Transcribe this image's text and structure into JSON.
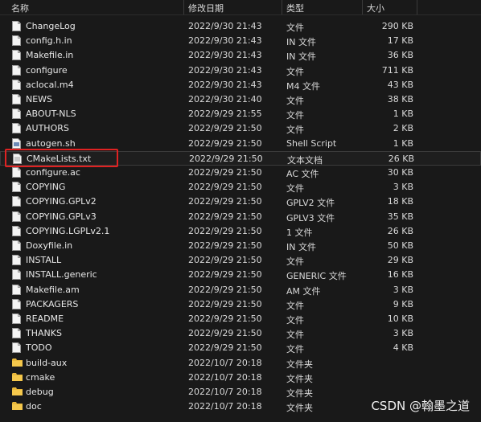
{
  "columns": {
    "name": "名称",
    "date": "修改日期",
    "type": "类型",
    "size": "大小"
  },
  "files": [
    {
      "name": "ChangeLog",
      "date": "2022/9/30 21:43",
      "type": "文件",
      "size": "290 KB",
      "icon": "file-icon"
    },
    {
      "name": "config.h.in",
      "date": "2022/9/30 21:43",
      "type": "IN 文件",
      "size": "17 KB",
      "icon": "file-icon"
    },
    {
      "name": "Makefile.in",
      "date": "2022/9/30 21:43",
      "type": "IN 文件",
      "size": "36 KB",
      "icon": "file-icon"
    },
    {
      "name": "configure",
      "date": "2022/9/30 21:43",
      "type": "文件",
      "size": "711 KB",
      "icon": "file-icon"
    },
    {
      "name": "aclocal.m4",
      "date": "2022/9/30 21:43",
      "type": "M4 文件",
      "size": "43 KB",
      "icon": "file-icon"
    },
    {
      "name": "NEWS",
      "date": "2022/9/30 21:40",
      "type": "文件",
      "size": "38 KB",
      "icon": "file-icon"
    },
    {
      "name": "ABOUT-NLS",
      "date": "2022/9/29 21:55",
      "type": "文件",
      "size": "1 KB",
      "icon": "file-icon"
    },
    {
      "name": "AUTHORS",
      "date": "2022/9/29 21:50",
      "type": "文件",
      "size": "2 KB",
      "icon": "file-icon"
    },
    {
      "name": "autogen.sh",
      "date": "2022/9/29 21:50",
      "type": "Shell Script",
      "size": "1 KB",
      "icon": "script-file-icon"
    },
    {
      "name": "CMakeLists.txt",
      "date": "2022/9/29 21:50",
      "type": "文本文档",
      "size": "26 KB",
      "icon": "text-file-icon"
    },
    {
      "name": "configure.ac",
      "date": "2022/9/29 21:50",
      "type": "AC 文件",
      "size": "30 KB",
      "icon": "file-icon"
    },
    {
      "name": "COPYING",
      "date": "2022/9/29 21:50",
      "type": "文件",
      "size": "3 KB",
      "icon": "file-icon"
    },
    {
      "name": "COPYING.GPLv2",
      "date": "2022/9/29 21:50",
      "type": "GPLV2 文件",
      "size": "18 KB",
      "icon": "file-icon"
    },
    {
      "name": "COPYING.GPLv3",
      "date": "2022/9/29 21:50",
      "type": "GPLV3 文件",
      "size": "35 KB",
      "icon": "file-icon"
    },
    {
      "name": "COPYING.LGPLv2.1",
      "date": "2022/9/29 21:50",
      "type": "1 文件",
      "size": "26 KB",
      "icon": "file-icon"
    },
    {
      "name": "Doxyfile.in",
      "date": "2022/9/29 21:50",
      "type": "IN 文件",
      "size": "50 KB",
      "icon": "file-icon"
    },
    {
      "name": "INSTALL",
      "date": "2022/9/29 21:50",
      "type": "文件",
      "size": "29 KB",
      "icon": "file-icon"
    },
    {
      "name": "INSTALL.generic",
      "date": "2022/9/29 21:50",
      "type": "GENERIC 文件",
      "size": "16 KB",
      "icon": "file-icon"
    },
    {
      "name": "Makefile.am",
      "date": "2022/9/29 21:50",
      "type": "AM 文件",
      "size": "3 KB",
      "icon": "file-icon"
    },
    {
      "name": "PACKAGERS",
      "date": "2022/9/29 21:50",
      "type": "文件",
      "size": "9 KB",
      "icon": "file-icon"
    },
    {
      "name": "README",
      "date": "2022/9/29 21:50",
      "type": "文件",
      "size": "10 KB",
      "icon": "file-icon"
    },
    {
      "name": "THANKS",
      "date": "2022/9/29 21:50",
      "type": "文件",
      "size": "3 KB",
      "icon": "file-icon"
    },
    {
      "name": "TODO",
      "date": "2022/9/29 21:50",
      "type": "文件",
      "size": "4 KB",
      "icon": "file-icon"
    },
    {
      "name": "build-aux",
      "date": "2022/10/7 20:18",
      "type": "文件夹",
      "size": "",
      "icon": "folder-icon"
    },
    {
      "name": "cmake",
      "date": "2022/10/7 20:18",
      "type": "文件夹",
      "size": "",
      "icon": "folder-icon"
    },
    {
      "name": "debug",
      "date": "2022/10/7 20:18",
      "type": "文件夹",
      "size": "",
      "icon": "folder-icon"
    },
    {
      "name": "doc",
      "date": "2022/10/7 20:18",
      "type": "文件夹",
      "size": "",
      "icon": "folder-icon"
    }
  ],
  "watermark": "CSDN @翰墨之道",
  "colors": {
    "background": "#191919",
    "text": "#e6e6e6",
    "highlight_border": "#e02222",
    "folder": "#e8b73a"
  }
}
